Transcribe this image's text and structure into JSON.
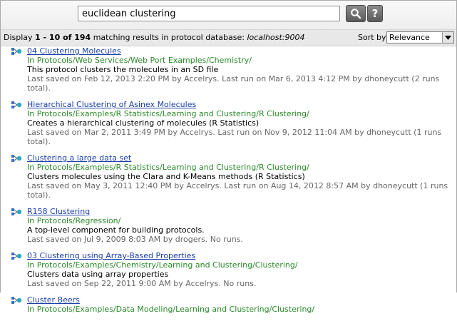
{
  "search": {
    "query": "euclidean clustering",
    "search_button_icon": "search-icon",
    "help_label": "?"
  },
  "summary": {
    "prefix": "Display ",
    "range": "1 - 10 of 194",
    "middle": " matching results in protocol database: ",
    "database": "localhost:9004"
  },
  "sort": {
    "label": "Sort by",
    "selected": "Relevance"
  },
  "results": [
    {
      "icon": "protocol-icon",
      "title": "04 Clustering Molecules",
      "path": "In Protocols/Web Services/Web Port Examples/Chemistry/",
      "description": "This protocol clusters the molecules in an SD file",
      "meta": "Last saved on Feb 12, 2013 2:20 PM by Accelrys.  Last run on Mar 6, 2013 4:12 PM by dhoneycutt (2 runs total)."
    },
    {
      "icon": "protocol-icon",
      "title": "Hierarchical Clustering of Asinex Molecules",
      "path": "In Protocols/Examples/R Statistics/Learning and Clustering/R Clustering/",
      "description": "Creates a hierarchical clustering of molecules (R Statistics)",
      "meta": "Last saved on Mar 2, 2011 3:49 PM by Accelrys.  Last run on Nov 9, 2012 11:04 AM by dhoneycutt (1 runs total)."
    },
    {
      "icon": "protocol-icon",
      "title": "Clustering a large data set",
      "path": "In Protocols/Examples/R Statistics/Learning and Clustering/R Clustering/",
      "description": "Clusters molecules using the Clara and K-Means methods (R Statistics)",
      "meta": "Last saved on May 3, 2011 12:40 PM by Accelrys.  Last run on Aug 14, 2012 8:57 AM by dhoneycutt (1 runs total)."
    },
    {
      "icon": "protocol-icon",
      "title": "R158 Clustering",
      "path": "In Protocols/Regression/",
      "description": "A top-level component for building protocols.",
      "meta": "Last saved on Jul 9, 2009 8:03 AM by drogers. No runs."
    },
    {
      "icon": "protocol-icon",
      "title": "03 Clustering using Array-Based Properties",
      "path": "In Protocols/Examples/Chemistry/Learning and Clustering/Clustering/",
      "description": "Clusters data using array properties",
      "meta": "Last saved on Sep 22, 2011 9:00 AM by Accelrys. No runs."
    },
    {
      "icon": "protocol-icon",
      "title": "Cluster Beers",
      "path": "In Protocols/Examples/Data Modeling/Learning and Clustering/Clustering/",
      "description": "",
      "meta": ""
    }
  ],
  "colors": {
    "link": "#1a3faa",
    "path": "#2a8a2a",
    "meta": "#666666",
    "button": "#6e6e6e"
  }
}
